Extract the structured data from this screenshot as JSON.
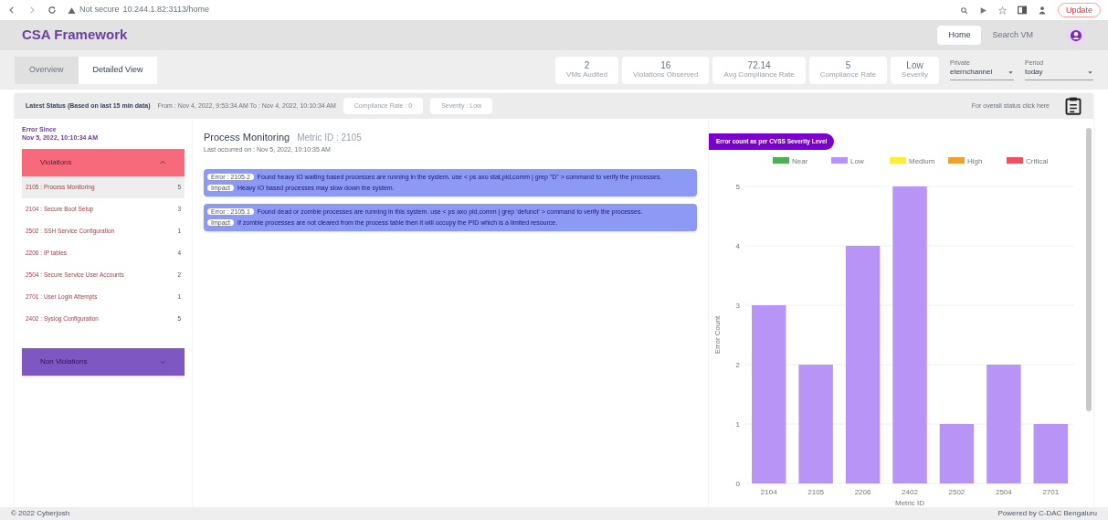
{
  "browser": {
    "security": "Not secure",
    "url": "10.244.1.82:3113/home",
    "update": "Update"
  },
  "header": {
    "title": "CSA Framework",
    "nav": [
      {
        "label": "Home",
        "selected": true
      },
      {
        "label": "Search VM",
        "selected": false
      }
    ]
  },
  "tabs": [
    {
      "label": "Overview",
      "selected": false
    },
    {
      "label": "Detailed View",
      "selected": true
    }
  ],
  "stats": [
    {
      "value": "2",
      "label": "VMs Audited"
    },
    {
      "value": "16",
      "label": "Violations Observed"
    },
    {
      "value": "72.14",
      "label": "Avg Compliance Rate"
    },
    {
      "value": "5",
      "label": "Compliance Rate"
    },
    {
      "value": "Low",
      "label": "Severity"
    }
  ],
  "filters": [
    {
      "label": "Private",
      "value": "eternchannel"
    },
    {
      "label": "Period",
      "value": "today"
    }
  ],
  "status": {
    "title": "Latest Status (Based on last 15 min data)",
    "range": "From : Nov 4, 2022, 9:53:34 AM  To : Nov 4, 2022, 10:10:34 AM",
    "chips": [
      "Compliance Rate : 0",
      "Severity : Low"
    ],
    "link": "For overall status click here"
  },
  "error_since": {
    "label": "Error Since",
    "date": "Nov 5, 2022, 10:10:34 AM"
  },
  "violations": {
    "title": "Violations",
    "expanded": true,
    "items": [
      {
        "label": "2105 : Process Monitoring",
        "count": "5",
        "selected": true
      },
      {
        "label": "2104 : Secure Boot Setup",
        "count": "3",
        "selected": false
      },
      {
        "label": "2502 : SSH Service Configuration",
        "count": "1",
        "selected": false
      },
      {
        "label": "2206 : IP tables",
        "count": "4",
        "selected": false
      },
      {
        "label": "2504 : Secure Service User Accounts",
        "count": "2",
        "selected": false
      },
      {
        "label": "2701 : User Login Attempts",
        "count": "1",
        "selected": false
      },
      {
        "label": "2402 : Syslog Configuration",
        "count": "5",
        "selected": false
      }
    ]
  },
  "non_violations": {
    "title": "Non Violations",
    "expanded": false
  },
  "detail": {
    "title": "Process Monitoring",
    "metric": "Metric ID : 2105",
    "last": "Last occurred on : Nov 5, 2022, 10:10:35 AM",
    "errors": [
      {
        "code": "Error : 2105.2",
        "text": "Found heavy IO waiting based processes are running in the system. use < ps axo stat,pid,comm | grep \"D\" > command to verify the processes.",
        "impact_label": "Impact",
        "impact": "Heavy IO based processes may slow down the system."
      },
      {
        "code": "Error : 2105.1",
        "text": "Found dead or zombie processes are running in this system. use < ps axo pid,comm | grep 'defunct' > command to verify the processes.",
        "impact_label": "Impact",
        "impact": "If zombie processes are not cleared from the process table then it will occupy the PID which is a limited resource."
      }
    ]
  },
  "chart": {
    "badge": "Error count as per CVSS Severity Level",
    "chart_data": {
      "type": "bar",
      "xlabel": "Metric ID",
      "ylabel": "Error Count",
      "categories": [
        "2104",
        "2105",
        "2206",
        "2402",
        "2502",
        "2504",
        "2701"
      ],
      "series": [
        {
          "name": "Near",
          "color": "#4caf50",
          "values": [
            0,
            0,
            0,
            0,
            0,
            0,
            0
          ]
        },
        {
          "name": "Low",
          "color": "#b794f6",
          "values": [
            3,
            2,
            4,
            5,
            1,
            2,
            1
          ]
        },
        {
          "name": "Medium",
          "color": "#ffeb3b",
          "values": [
            0,
            0,
            0,
            0,
            0,
            0,
            0
          ]
        },
        {
          "name": "High",
          "color": "#f0a030",
          "values": [
            0,
            0,
            0,
            0,
            0,
            0,
            0
          ]
        },
        {
          "name": "Critical",
          "color": "#f05060",
          "values": [
            0,
            0,
            0,
            0,
            0,
            0,
            0
          ]
        }
      ],
      "ylim": [
        0,
        5
      ],
      "yticks": [
        0,
        1,
        2,
        3,
        4,
        5
      ],
      "grid": true
    }
  },
  "footer": {
    "left": "© 2022 Cyberjosh",
    "right": "Powered by C-DAC Bengaluru"
  }
}
